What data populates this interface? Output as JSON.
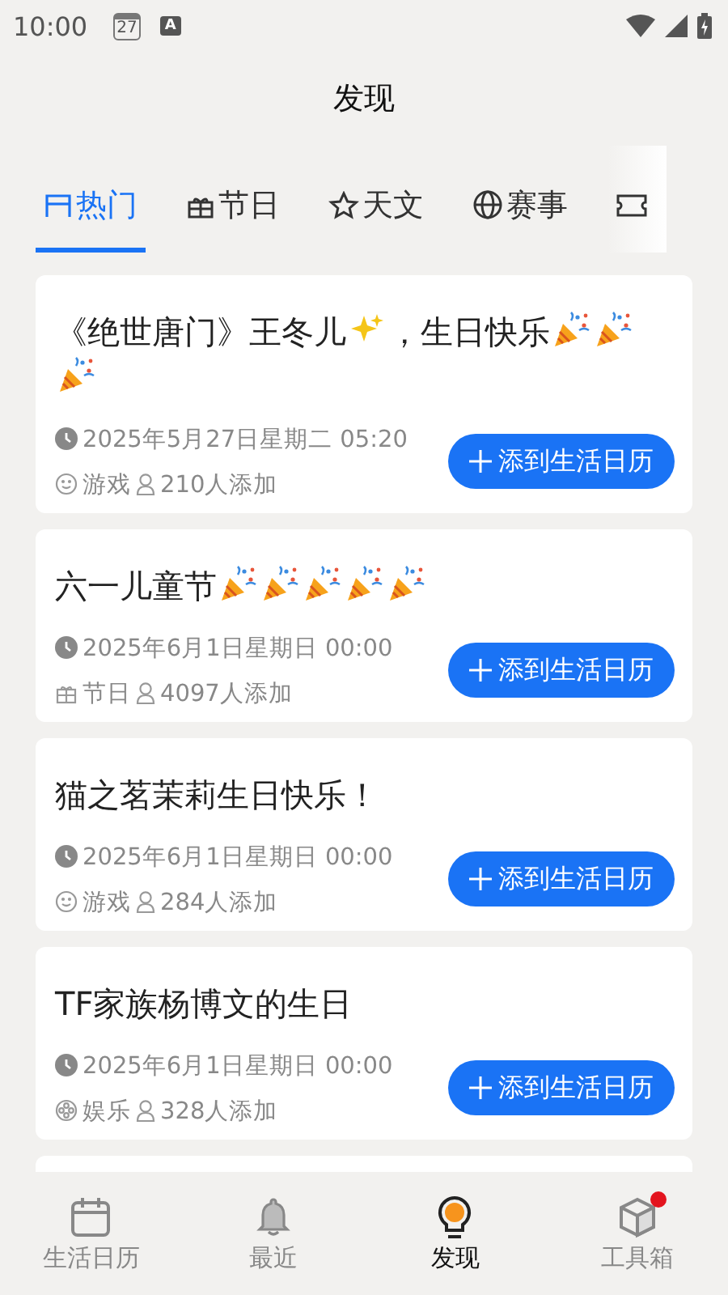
{
  "status_bar": {
    "time": "10:00",
    "calendar_day": "27",
    "input_letter": "A"
  },
  "header": {
    "title": "发现"
  },
  "tabs": [
    {
      "label": "热门",
      "selected": true
    },
    {
      "label": "节日",
      "selected": false
    },
    {
      "label": "天文",
      "selected": false
    },
    {
      "label": "赛事",
      "selected": false
    },
    {
      "selected": false
    }
  ],
  "events": [
    {
      "title_parts": [
        {
          "kind": "text",
          "text": "《绝世唐门》王冬儿"
        },
        {
          "kind": "sparkles"
        },
        {
          "kind": "text",
          "text": "，生日快乐"
        },
        {
          "kind": "popper"
        },
        {
          "kind": "popper"
        },
        {
          "kind": "popper"
        }
      ],
      "time": "2025年5月27日星期二 05:20",
      "kind": "game",
      "category": "游戏",
      "added": "210人添加",
      "button": "添到生活日历"
    },
    {
      "title_parts": [
        {
          "kind": "text",
          "text": "六一儿童节"
        },
        {
          "kind": "popper"
        },
        {
          "kind": "popper"
        },
        {
          "kind": "popper"
        },
        {
          "kind": "popper"
        },
        {
          "kind": "popper"
        }
      ],
      "time": "2025年6月1日星期日 00:00",
      "kind": "festival",
      "category": "节日",
      "added": "4097人添加",
      "button": "添到生活日历"
    },
    {
      "title_parts": [
        {
          "kind": "text",
          "text": "猫之茗茉莉生日快乐！"
        }
      ],
      "time": "2025年6月1日星期日 00:00",
      "kind": "game",
      "category": "游戏",
      "added": "284人添加",
      "button": "添到生活日历"
    },
    {
      "title_parts": [
        {
          "kind": "text",
          "text": "TF家族杨博文的生日"
        }
      ],
      "time": "2025年6月1日星期日 00:00",
      "kind": "entertainment",
      "category": "娱乐",
      "added": "328人添加",
      "button": "添到生活日历"
    }
  ],
  "bottom_nav": [
    {
      "label": "生活日历",
      "selected": false,
      "badge": false
    },
    {
      "label": "最近",
      "selected": false,
      "badge": false
    },
    {
      "label": "发现",
      "selected": true,
      "badge": false
    },
    {
      "label": "工具箱",
      "selected": false,
      "badge": true
    }
  ]
}
